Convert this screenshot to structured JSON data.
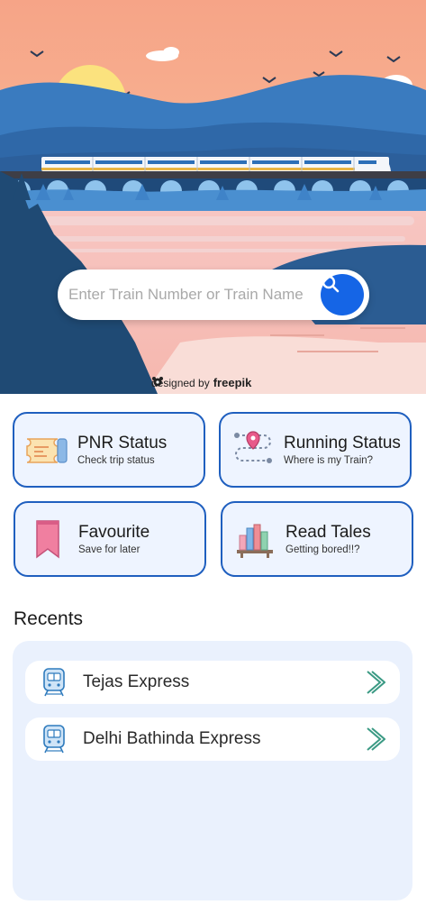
{
  "hero": {
    "search_placeholder": "Enter Train Number or Train Name",
    "credit_prefix": "designed by",
    "credit_brand": "freepik"
  },
  "cards": [
    {
      "title": "PNR Status",
      "subtitle": "Check trip status",
      "icon": "ticket-icon"
    },
    {
      "title": "Running Status",
      "subtitle": "Where is my Train?",
      "icon": "route-pin-icon"
    },
    {
      "title": "Favourite",
      "subtitle": "Save for later",
      "icon": "bookmark-icon"
    },
    {
      "title": "Read Tales",
      "subtitle": "Getting bored!!?",
      "icon": "books-icon"
    }
  ],
  "recents": {
    "title": "Recents",
    "items": [
      {
        "name": "Tejas Express",
        "icon": "train-icon"
      },
      {
        "name": "Delhi Bathinda Express",
        "icon": "train-icon"
      }
    ]
  },
  "colors": {
    "accent": "#1565e6",
    "card_border": "#1f5fbf",
    "card_bg": "#eef4ff",
    "panel_bg": "#eaf1fd"
  }
}
